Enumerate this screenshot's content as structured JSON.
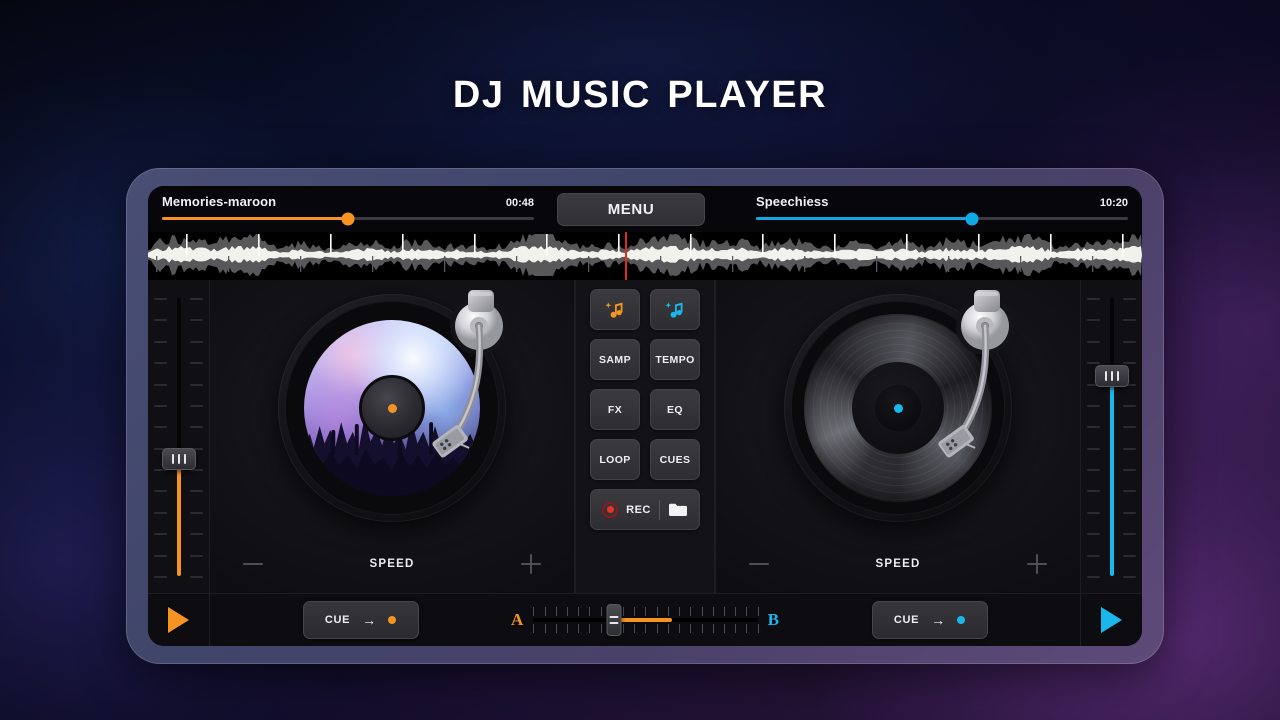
{
  "page": {
    "title": "DJ Music Player"
  },
  "theme": {
    "accent_a": "#f79421",
    "accent_b": "#1ab7ec",
    "rec_red": "#e4352c",
    "playhead_red": "#e02b24",
    "panel_bg": "#131317",
    "screen_bg": "#0c0c0f",
    "tablet_frame": "#494e74"
  },
  "deck_a": {
    "track_name": "Memories-maroon",
    "time": "00:48",
    "progress_percent": 50,
    "volume_percent": 42,
    "speed_label": "SPEED",
    "minus_icon": "minus-icon",
    "plus_icon": "plus-icon",
    "play_icon": "play-icon",
    "cue": {
      "label": "CUE",
      "arrow": "→"
    },
    "platter_art": "concert-crowd-album-art",
    "channel_label": "A"
  },
  "deck_b": {
    "track_name": "Speechiess",
    "time": "10:20",
    "progress_percent": 58,
    "volume_percent": 72,
    "speed_label": "SPEED",
    "minus_icon": "minus-icon",
    "plus_icon": "plus-icon",
    "play_icon": "play-icon",
    "cue": {
      "label": "CUE",
      "arrow": "→"
    },
    "platter_art": "vinyl-record",
    "channel_label": "B"
  },
  "header": {
    "menu_label": "MENU"
  },
  "center_panel": {
    "load_a": {
      "icon": "add-music-note-icon",
      "glyph": "♫",
      "color": "#f79421",
      "name": "load-track-deck-a"
    },
    "load_b": {
      "icon": "add-music-note-icon",
      "glyph": "♫",
      "color": "#1ab7ec",
      "name": "load-track-deck-b"
    },
    "buttons": [
      {
        "label": "SAMP"
      },
      {
        "label": "TEMPO"
      },
      {
        "label": "FX"
      },
      {
        "label": "EQ"
      },
      {
        "label": "LOOP"
      },
      {
        "label": "CUES"
      }
    ],
    "rec": {
      "label": "REC",
      "icon": "record-icon"
    },
    "folder": {
      "icon": "folder-icon"
    }
  },
  "crossfader": {
    "left_label": "A",
    "right_label": "B",
    "position_percent": 36,
    "fill_to_percent": 62
  },
  "waveform": {
    "playhead_percent": 48
  }
}
